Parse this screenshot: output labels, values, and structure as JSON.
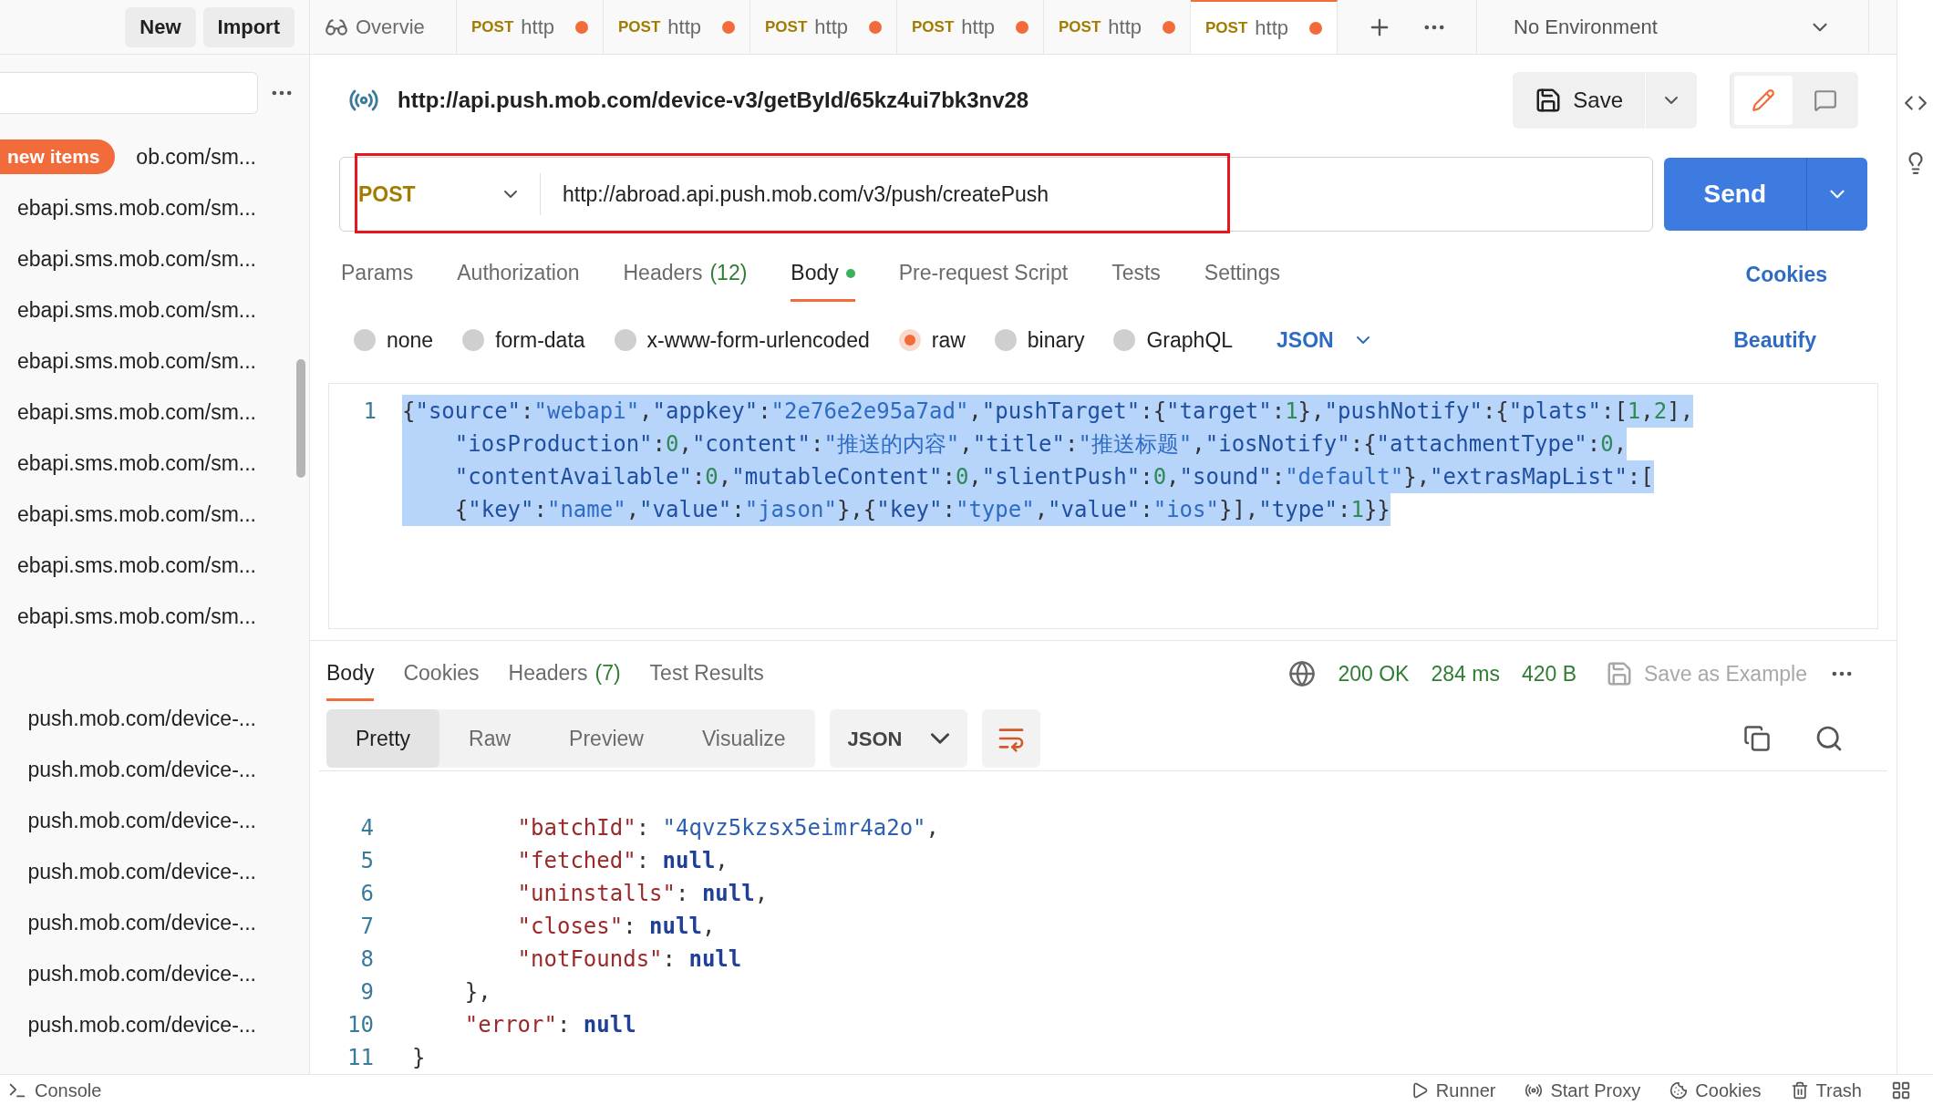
{
  "sidebar": {
    "buttons": [
      "New",
      "Import"
    ],
    "badge": "new items",
    "groups": [
      {
        "items": [
          "ob.com/sm...",
          "ebapi.sms.mob.com/sm...",
          "ebapi.sms.mob.com/sm...",
          "ebapi.sms.mob.com/sm...",
          "ebapi.sms.mob.com/sm...",
          "ebapi.sms.mob.com/sm...",
          "ebapi.sms.mob.com/sm...",
          "ebapi.sms.mob.com/sm...",
          "ebapi.sms.mob.com/sm...",
          "ebapi.sms.mob.com/sm..."
        ]
      },
      {
        "items": [
          "push.mob.com/device-...",
          "push.mob.com/device-...",
          "push.mob.com/device-...",
          "push.mob.com/device-...",
          "push.mob.com/device-...",
          "push.mob.com/device-...",
          "push.mob.com/device-..."
        ]
      }
    ]
  },
  "tabs": [
    {
      "kind": "overview",
      "label": "Overvie",
      "selected": false,
      "unsaved": false
    },
    {
      "kind": "request",
      "method": "POST",
      "label": "http",
      "selected": false,
      "unsaved": true
    },
    {
      "kind": "request",
      "method": "POST",
      "label": "http",
      "selected": false,
      "unsaved": true
    },
    {
      "kind": "request",
      "method": "POST",
      "label": "http",
      "selected": false,
      "unsaved": true
    },
    {
      "kind": "request",
      "method": "POST",
      "label": "http",
      "selected": false,
      "unsaved": true
    },
    {
      "kind": "request",
      "method": "POST",
      "label": "http",
      "selected": false,
      "unsaved": true
    },
    {
      "kind": "request",
      "method": "POST",
      "label": "http",
      "selected": true,
      "unsaved": true
    }
  ],
  "environment": "No Environment",
  "request": {
    "title": "http://api.push.mob.com/device-v3/getById/65kz4ui7bk3nv28",
    "save": "Save",
    "method": "POST",
    "url": "http://abroad.api.push.mob.com/v3/push/createPush",
    "highlighted": true,
    "send": "Send"
  },
  "request_tabs": [
    {
      "label": "Params",
      "selected": false
    },
    {
      "label": "Authorization",
      "selected": false
    },
    {
      "label": "Headers",
      "count": "(12)",
      "selected": false
    },
    {
      "label": "Body",
      "dot": true,
      "selected": true
    },
    {
      "label": "Pre-request Script",
      "selected": false
    },
    {
      "label": "Tests",
      "selected": false
    },
    {
      "label": "Settings",
      "selected": false
    }
  ],
  "cookies_link": "Cookies",
  "body_types": [
    {
      "label": "none",
      "selected": false
    },
    {
      "label": "form-data",
      "selected": false
    },
    {
      "label": "x-www-form-urlencoded",
      "selected": false
    },
    {
      "label": "raw",
      "selected": true
    },
    {
      "label": "binary",
      "selected": false
    },
    {
      "label": "GraphQL",
      "selected": false
    }
  ],
  "language": "JSON",
  "beautify": "Beautify",
  "editor": {
    "line_number": "1",
    "selected": true,
    "lines": [
      "{\"source\":\"webapi\",\"appkey\":\"2e76e2e95a7ad\",\"pushTarget\":{\"target\":1},\"pushNotify\":{\"plats\":[1,2],",
      "    \"iosProduction\":0,\"content\":\"推送的内容\",\"title\":\"推送标题\",\"iosNotify\":{\"attachmentType\":0,",
      "    \"contentAvailable\":0,\"mutableContent\":0,\"slientPush\":0,\"sound\":\"default\"},\"extrasMapList\":[",
      "    {\"key\":\"name\",\"value\":\"jason\"},{\"key\":\"type\",\"value\":\"ios\"}],\"type\":1}}"
    ]
  },
  "response": {
    "tabs": [
      {
        "label": "Body",
        "selected": true
      },
      {
        "label": "Cookies",
        "selected": false
      },
      {
        "label": "Headers",
        "count": "(7)",
        "selected": false
      },
      {
        "label": "Test Results",
        "selected": false
      }
    ],
    "status": "200 OK",
    "time": "284 ms",
    "size": "420 B",
    "save_example": "Save as Example",
    "views": [
      {
        "label": "Pretty",
        "selected": true
      },
      {
        "label": "Raw",
        "selected": false
      },
      {
        "label": "Preview",
        "selected": false
      },
      {
        "label": "Visualize",
        "selected": false
      }
    ],
    "format": "JSON",
    "lines": [
      {
        "number": "4",
        "text": "        \"batchId\": \"4qvz5kzsx5eimr4a2o\","
      },
      {
        "number": "5",
        "text": "        \"fetched\": null,"
      },
      {
        "number": "6",
        "text": "        \"uninstalls\": null,"
      },
      {
        "number": "7",
        "text": "        \"closes\": null,"
      },
      {
        "number": "8",
        "text": "        \"notFounds\": null"
      },
      {
        "number": "9",
        "text": "    },"
      },
      {
        "number": "10",
        "text": "    \"error\": null"
      },
      {
        "number": "11",
        "text": "}"
      }
    ]
  },
  "status_bar": {
    "left": "Console",
    "right": [
      "Runner",
      "Start Proxy",
      "Cookies",
      "Trash"
    ]
  }
}
